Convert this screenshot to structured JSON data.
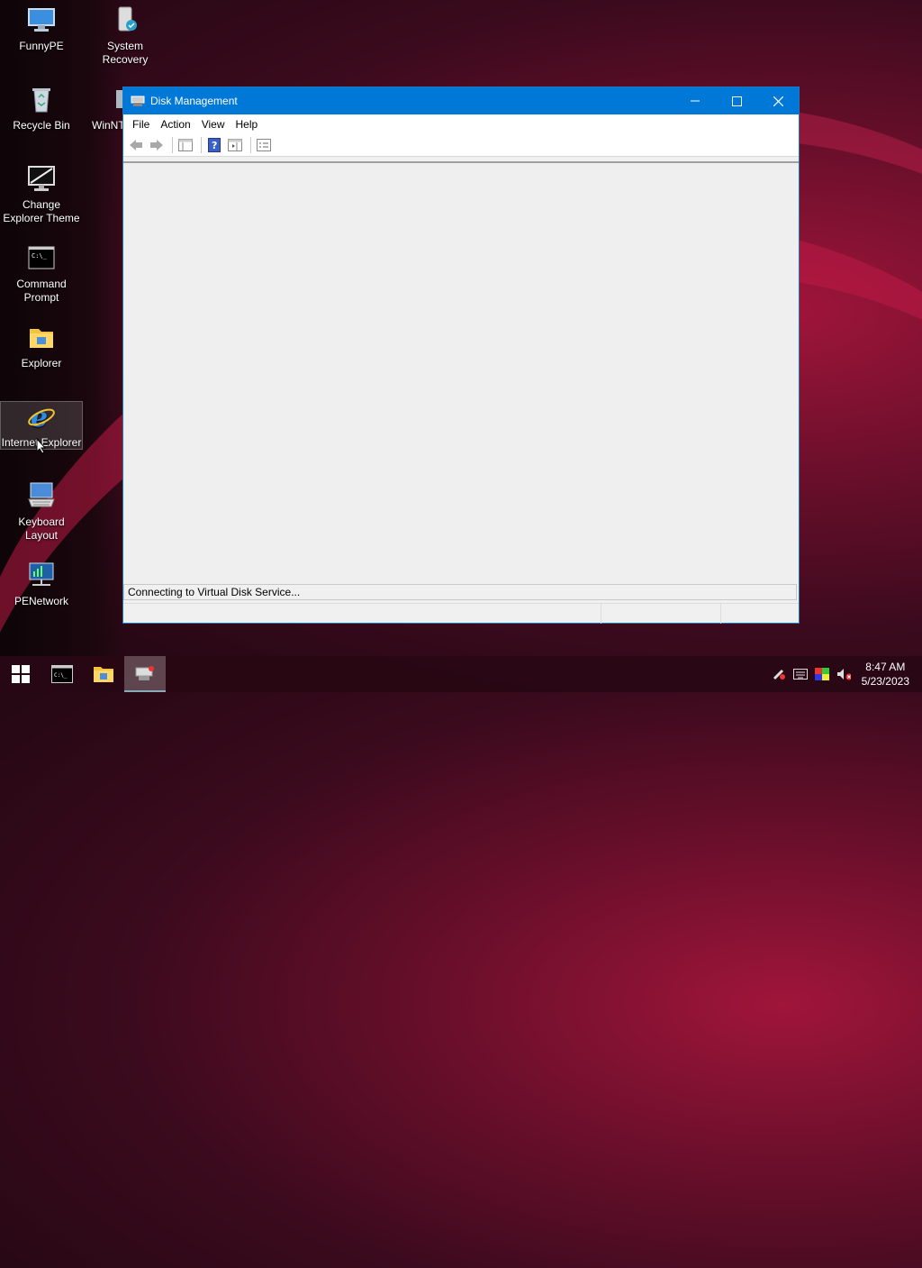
{
  "desktop": {
    "icons": [
      {
        "label": "FunnyPE"
      },
      {
        "label": "System Recovery"
      },
      {
        "label": "Recycle Bin"
      },
      {
        "label": "WinNT"
      },
      {
        "label": "Change Explorer Theme"
      },
      {
        "label": "Command Prompt"
      },
      {
        "label": "Explorer"
      },
      {
        "label": "Internet Explorer"
      },
      {
        "label": "Keyboard Layout"
      },
      {
        "label": "PENetwork"
      }
    ]
  },
  "window": {
    "title": "Disk Management",
    "menu": [
      "File",
      "Action",
      "View",
      "Help"
    ],
    "status_text": "Connecting to Virtual Disk Service..."
  },
  "taskbar": {
    "clock_time": "8:47 AM",
    "clock_date": "5/23/2023"
  },
  "colors": {
    "titlebar": "#0078d7",
    "desktop_accent": "#a0153a"
  }
}
